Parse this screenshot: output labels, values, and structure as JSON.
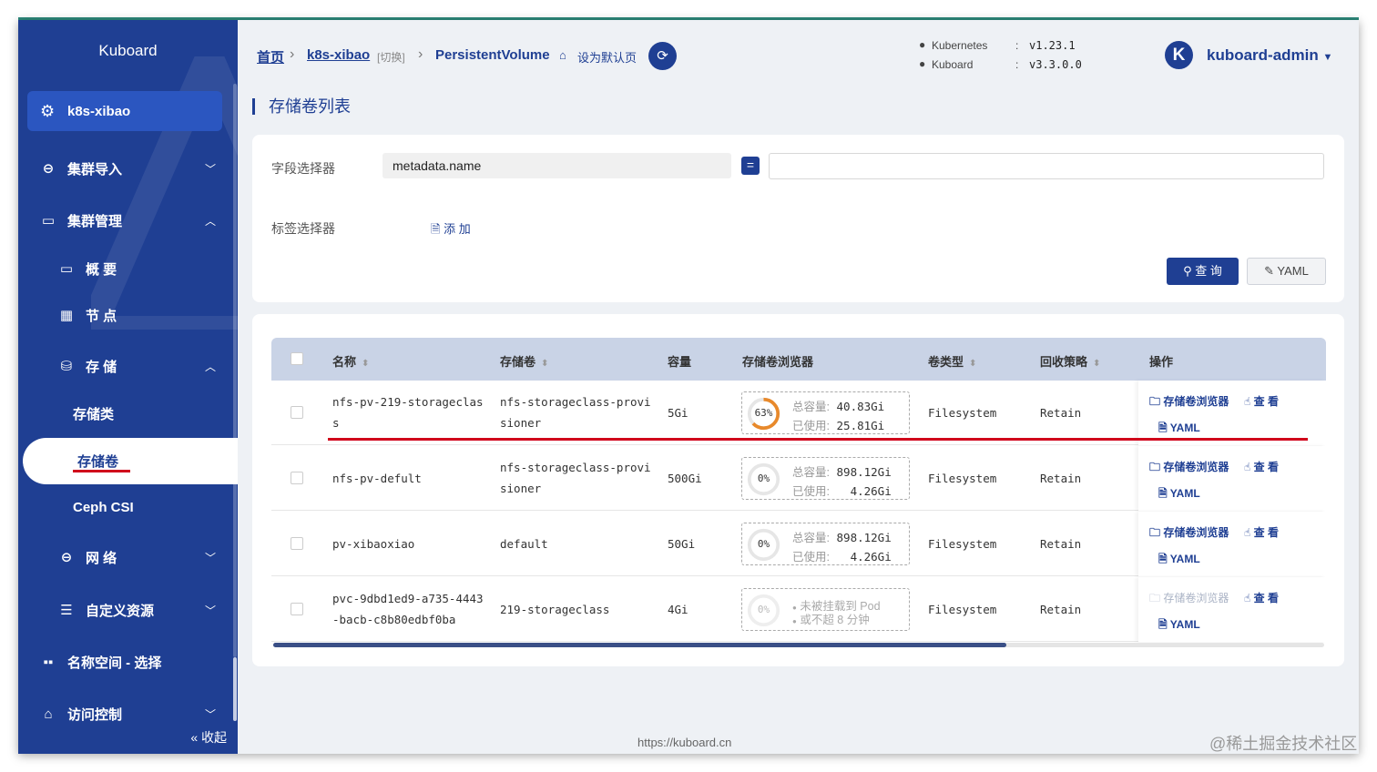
{
  "sidebar": {
    "logo": "Kuboard",
    "cluster": "k8s-xibao",
    "items": [
      {
        "label": "集群导入"
      },
      {
        "label": "集群管理"
      },
      {
        "label": "概 要"
      },
      {
        "label": "节 点"
      },
      {
        "label": "存 储"
      },
      {
        "label": "存储类"
      },
      {
        "label": "存储卷"
      },
      {
        "label": "Ceph CSI"
      },
      {
        "label": "网 络"
      },
      {
        "label": "自定义资源"
      },
      {
        "label": "名称空间 - 选择"
      },
      {
        "label": "访问控制"
      }
    ],
    "collapse": "« 收起"
  },
  "header": {
    "breadcrumb": {
      "home": "首页",
      "cluster": "k8s-xibao",
      "switch": "[切换]",
      "current": "PersistentVolume",
      "set_default": "设为默认页"
    },
    "versions": {
      "k8s_label": "Kubernetes",
      "k8s_value": "v1.23.1",
      "kuboard_label": "Kuboard",
      "kuboard_value": "v3.3.0.0",
      "colon": ":"
    },
    "avatar": "K",
    "user": "kuboard-admin"
  },
  "page_title": "存储卷列表",
  "filter": {
    "field_label": "字段选择器",
    "field_name": "metadata.name",
    "eq": "=",
    "tag_label": "标签选择器",
    "add": "添 加",
    "query": "查 询",
    "yaml": "YAML"
  },
  "table": {
    "headers": [
      "名称",
      "存储卷",
      "容量",
      "存储卷浏览器",
      "卷类型",
      "回收策略",
      "操作"
    ],
    "rows": [
      {
        "name1": "nfs-pv-219-storageclas",
        "name2": "s",
        "sc1": "nfs-storageclass-provi",
        "sc2": "sioner",
        "capacity": "5Gi",
        "pct": "63%",
        "total_k": "总容量:",
        "total": "40.83Gi",
        "used_k": "已使用:",
        "used": "25.81Gi",
        "type": "Filesystem",
        "policy": "Retain"
      },
      {
        "name1": "nfs-pv-defult",
        "name2": "",
        "sc1": "nfs-storageclass-provi",
        "sc2": "sioner",
        "capacity": "500Gi",
        "pct": "0%",
        "total_k": "总容量:",
        "total": "898.12Gi",
        "used_k": "已使用:",
        "used": "4.26Gi",
        "type": "Filesystem",
        "policy": "Retain"
      },
      {
        "name1": "pv-xibaoxiao",
        "name2": "",
        "sc1": "default",
        "sc2": "",
        "capacity": "50Gi",
        "pct": "0%",
        "total_k": "总容量:",
        "total": "898.12Gi",
        "used_k": "已使用:",
        "used": "4.26Gi",
        "type": "Filesystem",
        "policy": "Retain"
      },
      {
        "name1": "pvc-9dbd1ed9-a735-4443",
        "name2": "-bacb-c8b80edbf0ba",
        "sc1": "219-storageclass",
        "sc2": "",
        "capacity": "4Gi",
        "pct": "0%",
        "note1": "未被挂载到 Pod",
        "note2": "或不超 8 分钟",
        "type": "Filesystem",
        "policy": "Retain"
      }
    ],
    "ops": {
      "browser": "存储卷浏览器",
      "view": "查 看",
      "yaml": "YAML"
    },
    "usage_fraction": [
      0.63,
      0.0,
      0.0,
      0.0
    ]
  },
  "footer_url": "https://kuboard.cn",
  "watermark": "@稀土掘金技术社区",
  "colors": {
    "primary": "#1f3f93",
    "accent_ring": "#e8892b",
    "highlight": "#d0021b"
  }
}
